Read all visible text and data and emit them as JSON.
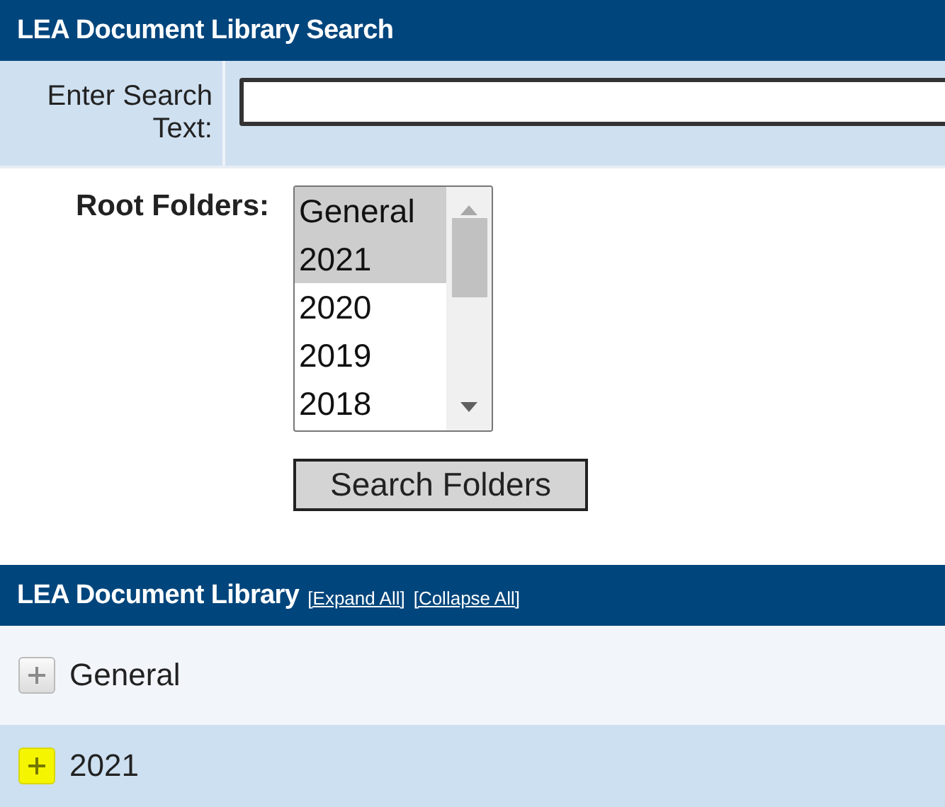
{
  "search_panel": {
    "title": "LEA Document Library Search",
    "search_label": "Enter Search Text:",
    "root_folders_label": "Root Folders:",
    "root_folders": [
      {
        "label": "General",
        "selected": true
      },
      {
        "label": "2021",
        "selected": true
      },
      {
        "label": "2020",
        "selected": false
      },
      {
        "label": "2019",
        "selected": false
      },
      {
        "label": "2018",
        "selected": false
      }
    ],
    "search_button": "Search Folders"
  },
  "library": {
    "title": "LEA Document Library",
    "links": [
      "[Expand All]",
      "[Collapse All]"
    ],
    "items": [
      {
        "label": "General",
        "expanded": false,
        "highlighted": false
      },
      {
        "label": "2021",
        "expanded": false,
        "highlighted": true
      }
    ]
  }
}
